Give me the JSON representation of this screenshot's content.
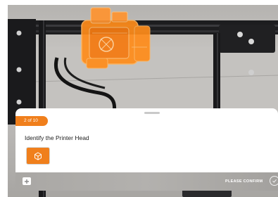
{
  "camera": {
    "ar_target": "printer-head"
  },
  "sheet": {
    "step_badge": "2 of 10",
    "instruction": "Identify the Printer Head",
    "part_icon": "cube-icon"
  },
  "bottom_bar": {
    "add_icon": "plus-icon",
    "confirm_label": "PLEASE CONFIRM",
    "confirm_icon": "check-circle-icon"
  },
  "colors": {
    "accent": "#f07f1c",
    "ar_overlay": "#ff8c1a"
  }
}
